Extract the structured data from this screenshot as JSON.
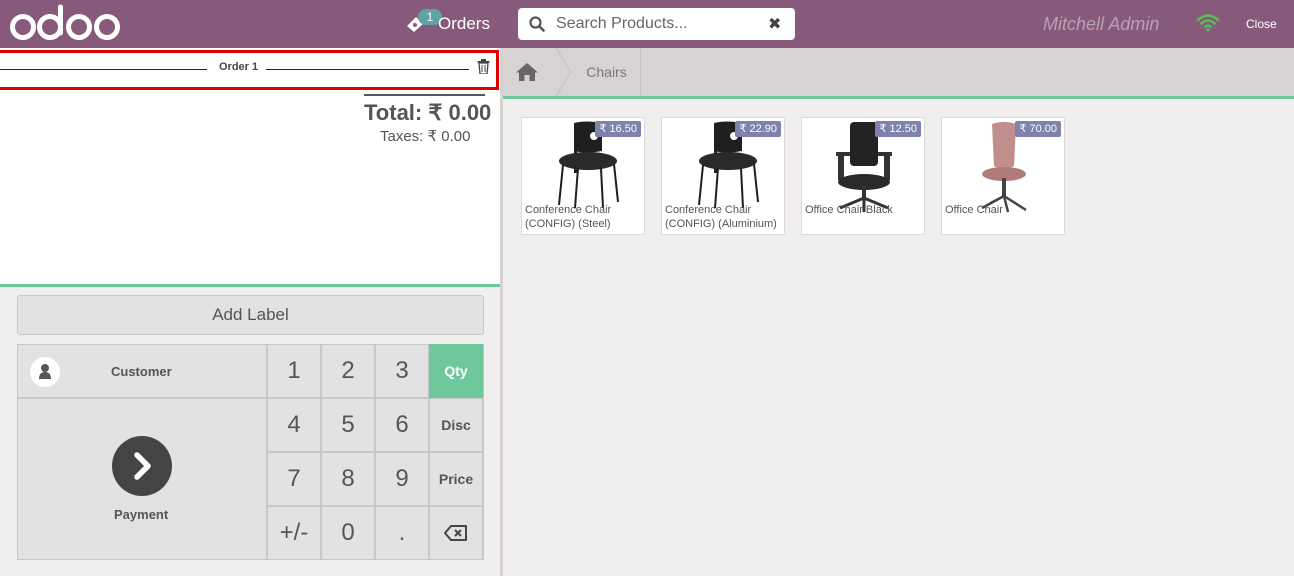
{
  "header": {
    "logo_text": "odoo",
    "orders_count": "1",
    "orders_label": "Orders",
    "search_placeholder": "Search Products...",
    "user_name": "Mitchell Admin",
    "close_label": "Close"
  },
  "order": {
    "tab_title": "Order 1",
    "total": "Total: ₹ 0.00",
    "taxes": "Taxes: ₹ 0.00"
  },
  "controls": {
    "add_label": "Add Label",
    "customer_label": "Customer",
    "payment_label": "Payment"
  },
  "numpad": {
    "keys": [
      "1",
      "2",
      "3",
      "4",
      "5",
      "6",
      "7",
      "8",
      "9",
      "+/-",
      "0",
      "."
    ],
    "modes": [
      "Qty",
      "Disc",
      "Price"
    ],
    "active_mode": "Qty"
  },
  "breadcrumb": {
    "category": "Chairs"
  },
  "products": [
    {
      "name": "Conference Chair (CONFIG) (Steel)",
      "price": "₹ 16.50",
      "icon": "conference-chair-image"
    },
    {
      "name": "Conference Chair (CONFIG) (Aluminium)",
      "price": "₹ 22.90",
      "icon": "conference-chair-image"
    },
    {
      "name": "Office Chair Black",
      "price": "₹ 12.50",
      "icon": "office-chair-black-image"
    },
    {
      "name": "Office Chair",
      "price": "₹ 70.00",
      "icon": "office-chair-pink-image"
    }
  ],
  "colors": {
    "header": "#875A7B",
    "accent": "#6ec89b",
    "price_tag": "#7f82ac",
    "selected_order": "#e00000"
  }
}
